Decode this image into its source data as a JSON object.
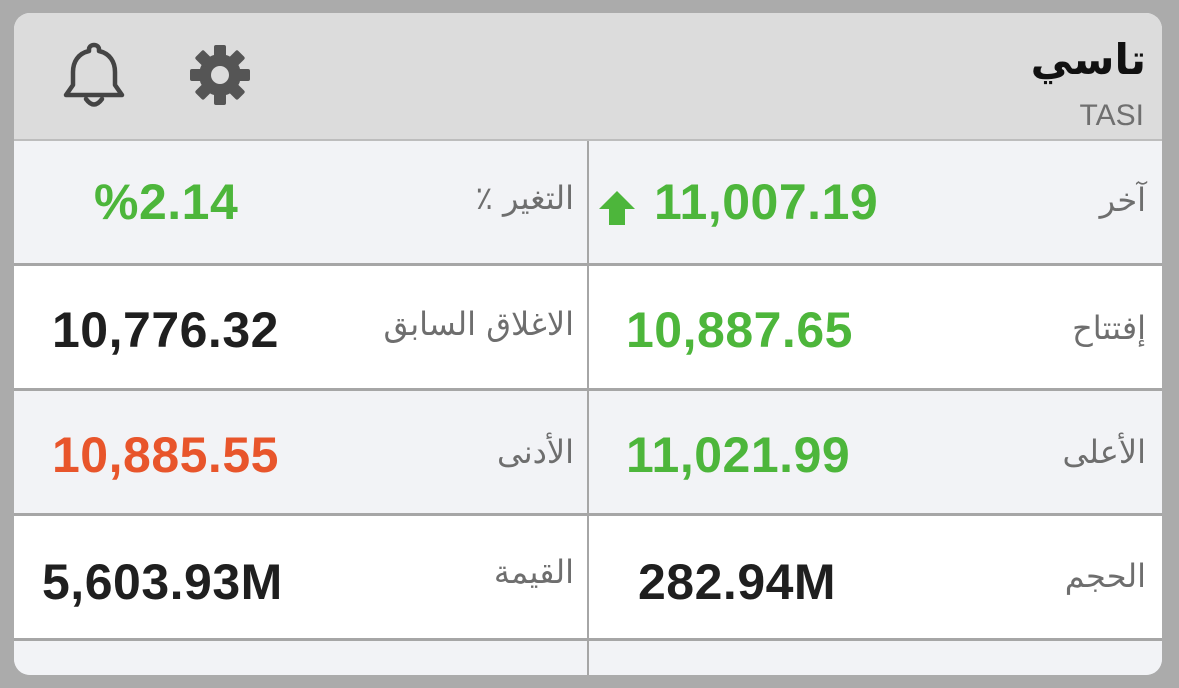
{
  "header": {
    "title_ar": "تاسي",
    "title_en": "TASI",
    "bell_icon": "bell-icon",
    "gear_icon": "gear-icon"
  },
  "colors": {
    "positive": "#4db63b",
    "negative": "#e8552b",
    "neutral": "#1f1f1f"
  },
  "rows": [
    {
      "right": {
        "label": "آخر",
        "value": "11,007.19",
        "trend": "up",
        "color": "positive"
      },
      "left": {
        "label": "التغير ٪",
        "value": "%2.14",
        "color": "positive"
      }
    },
    {
      "right": {
        "label": "إفتتاح",
        "value": "10,887.65",
        "color": "positive"
      },
      "left": {
        "label": "الاغلاق السابق",
        "value": "10,776.32",
        "color": "neutral"
      }
    },
    {
      "right": {
        "label": "الأعلى",
        "value": "11,021.99",
        "color": "positive"
      },
      "left": {
        "label": "الأدنى",
        "value": "10,885.55",
        "color": "negative"
      }
    },
    {
      "right": {
        "label": "الحجم",
        "value": "282.94M",
        "color": "neutral"
      },
      "left": {
        "label": "القيمة",
        "value": "5,603.93M",
        "color": "neutral"
      }
    }
  ]
}
